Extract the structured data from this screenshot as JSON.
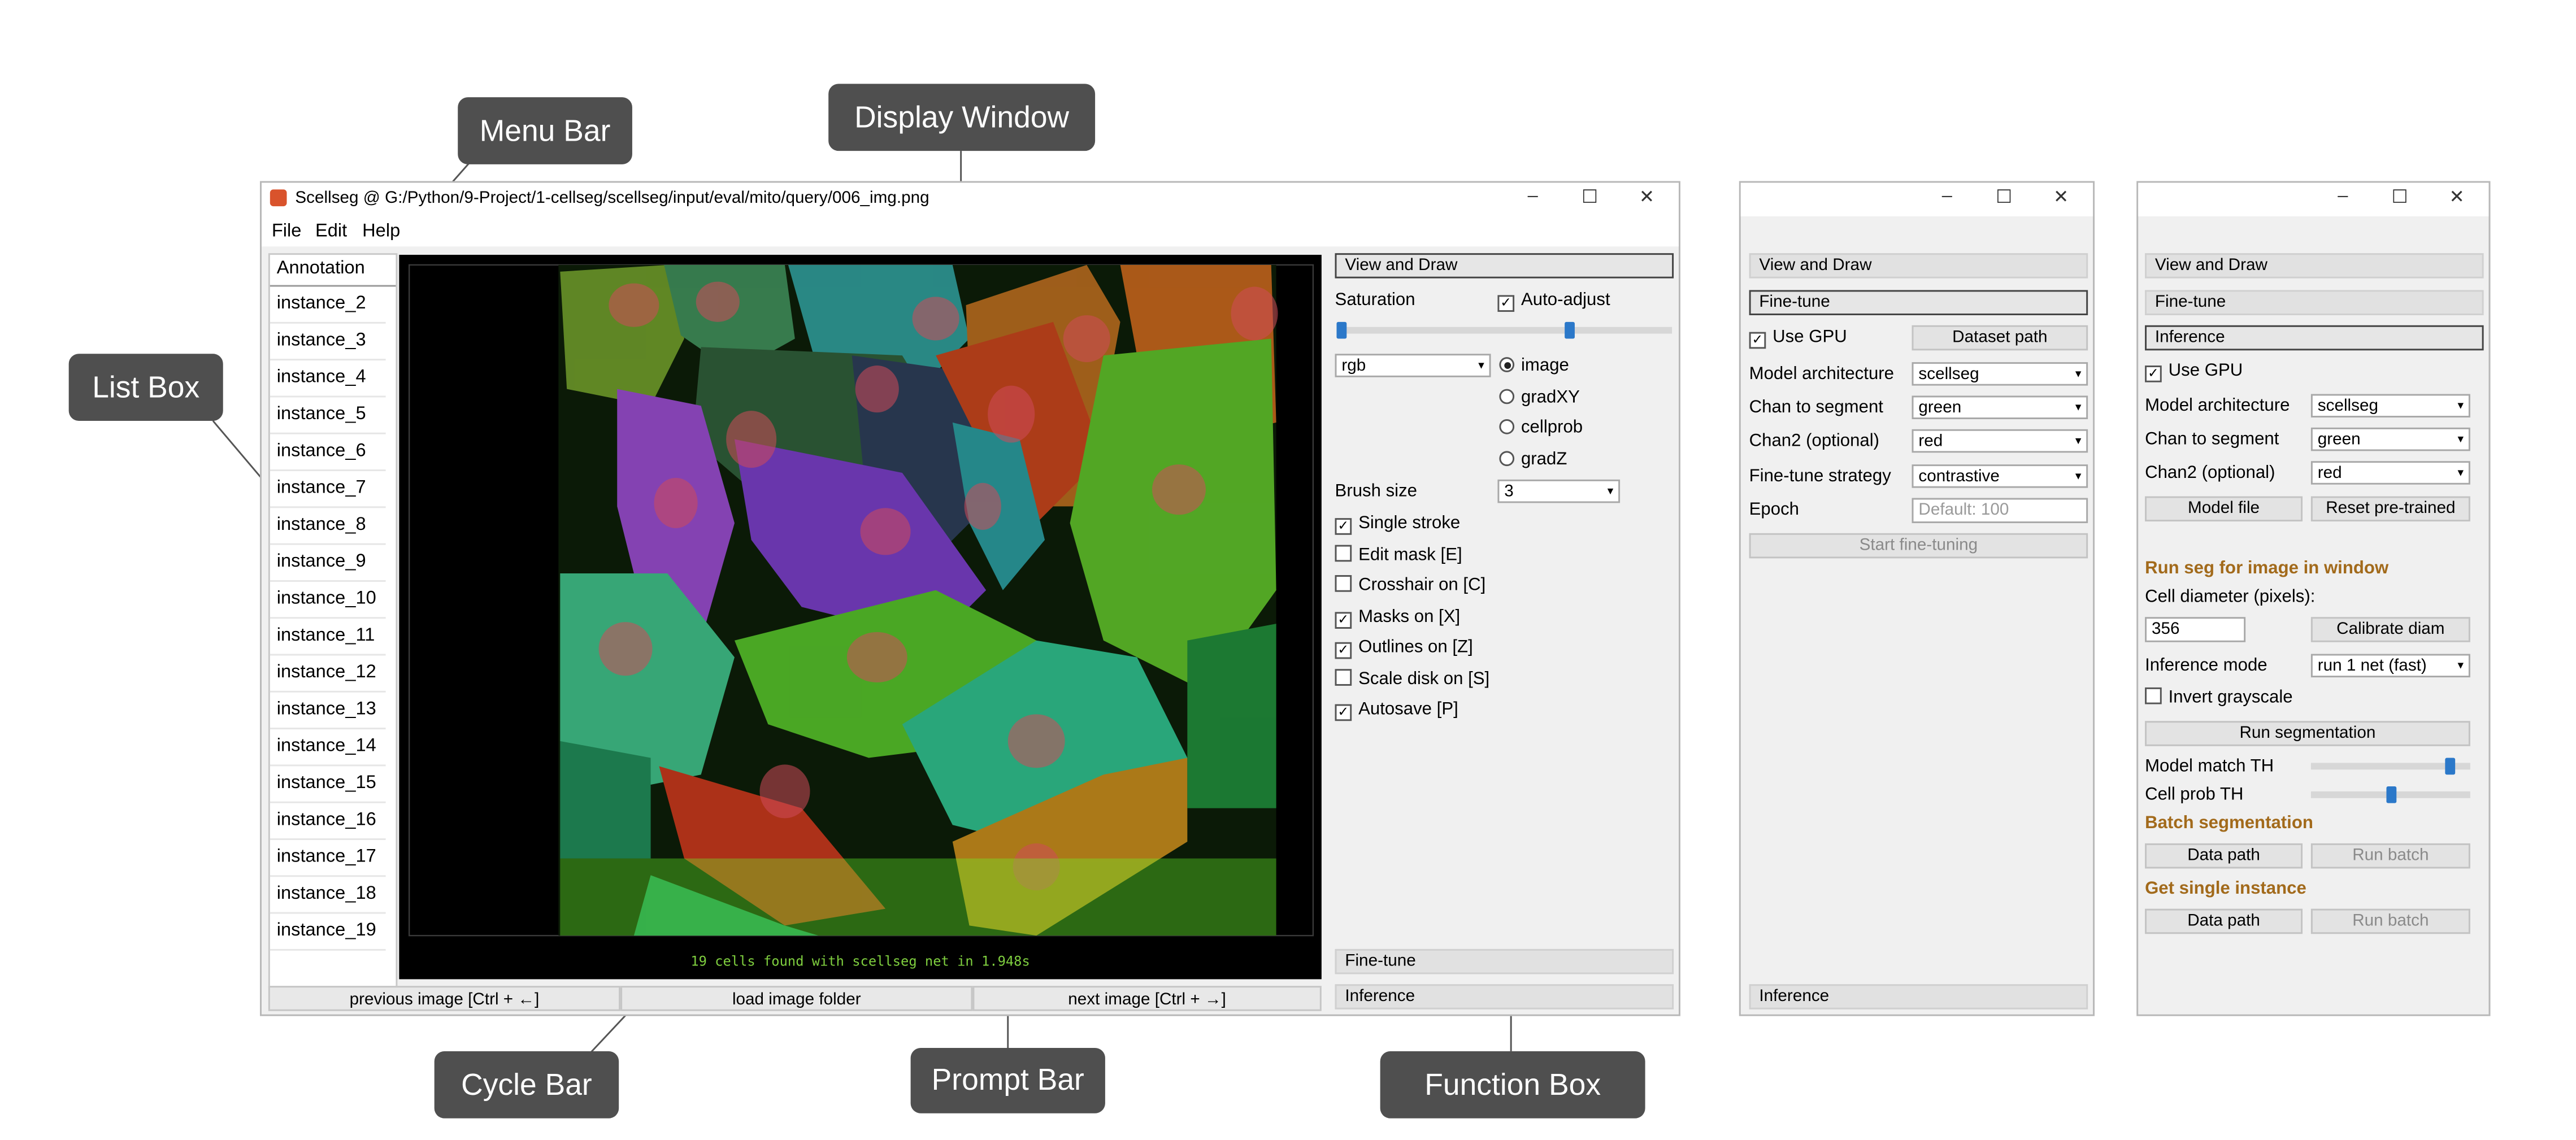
{
  "callouts": {
    "menu_bar": "Menu Bar",
    "display_window": "Display Window",
    "list_box": "List Box",
    "cycle_bar": "Cycle Bar",
    "prompt_bar": "Prompt Bar",
    "function_box": "Function Box"
  },
  "main_window": {
    "title": "Scellseg @ G:/Python/9-Project/1-cellseg/scellseg/input/eval/mito/query/006_img.png",
    "window_controls": [
      "–",
      "☐",
      "✕"
    ],
    "menu": [
      "File",
      "Edit",
      "Help"
    ],
    "list_header": "Annotation",
    "list_items": [
      "instance_2",
      "instance_3",
      "instance_4",
      "instance_5",
      "instance_6",
      "instance_7",
      "instance_8",
      "instance_9",
      "instance_10",
      "instance_11",
      "instance_12",
      "instance_13",
      "instance_14",
      "instance_15",
      "instance_16",
      "instance_17",
      "instance_18",
      "instance_19"
    ],
    "prompt_text": "19 cells found with scellseg net in 1.948s",
    "cycle": {
      "previous": "previous image [Ctrl + ←]",
      "load": "load image folder",
      "next": "next image [Ctrl + →]"
    },
    "panel": {
      "view_and_draw": "View and Draw",
      "saturation_label": "Saturation",
      "auto_adjust_label": "Auto-adjust",
      "auto_adjust_checked": true,
      "saturation_low": 0.0,
      "saturation_high": 0.7,
      "color_combo": "rgb",
      "radios": [
        {
          "label": "image",
          "checked": true
        },
        {
          "label": "gradXY",
          "checked": false
        },
        {
          "label": "cellprob",
          "checked": false
        },
        {
          "label": "gradZ",
          "checked": false
        }
      ],
      "brush_size_label": "Brush size",
      "brush_size": "3",
      "checks": [
        {
          "label": "Single stroke",
          "checked": true
        },
        {
          "label": "Edit mask [E]",
          "checked": false
        },
        {
          "label": "Crosshair on [C]",
          "checked": false
        },
        {
          "label": "Masks on [X]",
          "checked": true
        },
        {
          "label": "Outlines on [Z]",
          "checked": true
        },
        {
          "label": "Scale disk on [S]",
          "checked": false
        },
        {
          "label": "Autosave [P]",
          "checked": true
        }
      ],
      "fine_tune": "Fine-tune",
      "inference": "Inference"
    }
  },
  "finetune_window": {
    "window_controls": [
      "–",
      "☐",
      "✕"
    ],
    "view_and_draw": "View and Draw",
    "fine_tune": "Fine-tune",
    "use_gpu_label": "Use GPU",
    "use_gpu": true,
    "dataset_path": "Dataset path",
    "model_architecture_label": "Model architecture",
    "model_architecture": "scellseg",
    "chan_label": "Chan to segment",
    "chan": "green",
    "chan2_label": "Chan2 (optional)",
    "chan2": "red",
    "strategy_label": "Fine-tune strategy",
    "strategy": "contrastive",
    "epoch_label": "Epoch",
    "epoch_placeholder": "Default: 100",
    "start_button": "Start fine-tuning",
    "inference": "Inference"
  },
  "inference_window": {
    "window_controls": [
      "–",
      "☐",
      "✕"
    ],
    "view_and_draw": "View and Draw",
    "fine_tune": "Fine-tune",
    "inference": "Inference",
    "use_gpu_label": "Use GPU",
    "use_gpu": true,
    "model_architecture_label": "Model architecture",
    "model_architecture": "scellseg",
    "chan_label": "Chan to segment",
    "chan": "green",
    "chan2_label": "Chan2 (optional)",
    "chan2": "red",
    "model_file": "Model file",
    "reset_pretrained": "Reset pre-trained",
    "run_seg_title": "Run seg for image in window",
    "cell_diameter_label": "Cell diameter (pixels):",
    "cell_diameter": "356",
    "calibrate_diam": "Calibrate diam",
    "inference_mode_label": "Inference mode",
    "inference_mode": "run 1 net (fast)",
    "invert_label": "Invert grayscale",
    "invert": false,
    "run_segmentation": "Run segmentation",
    "model_match_label": "Model match TH",
    "model_match_value": 0.9,
    "cell_prob_label": "Cell prob TH",
    "cell_prob_value": 0.5,
    "batch_title": "Batch segmentation",
    "batch_data_path": "Data path",
    "batch_run": "Run batch",
    "single_title": "Get single instance",
    "single_data_path": "Data path",
    "single_run": "Run batch"
  },
  "colors": {
    "callout_bg": "#4f4f4f",
    "accent_slider": "#2b78c9",
    "section_title": "#a26a1b",
    "prompt_text": "#7fcf3f"
  }
}
